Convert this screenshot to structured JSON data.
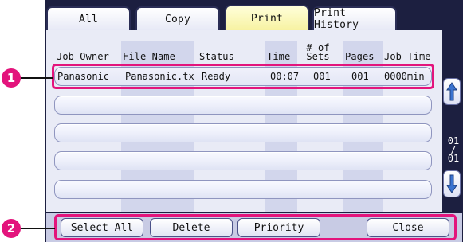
{
  "tabs": [
    {
      "label": "All",
      "active": false
    },
    {
      "label": "Copy",
      "active": false
    },
    {
      "label": "Print",
      "active": true
    },
    {
      "label": "Print History",
      "active": false
    }
  ],
  "columns": {
    "job_owner": "Job Owner",
    "file_name": "File Name",
    "status": "Status",
    "time": "Time",
    "sets_line1": "# of",
    "sets_line2": "Sets",
    "pages": "Pages",
    "job_time": "Job Time"
  },
  "jobs": [
    {
      "owner": "Panasonic",
      "file_name": "Panasonic.tx",
      "status": "Ready",
      "time": "00:07",
      "sets": "001",
      "pages": "001",
      "job_time": "0000min"
    }
  ],
  "pagination": {
    "current": "01",
    "separator": "/",
    "total": "01"
  },
  "buttons": {
    "select_all": "Select All",
    "delete": "Delete",
    "priority": "Priority",
    "close": "Close"
  },
  "callouts": [
    "1",
    "2"
  ],
  "colors": {
    "panel": "#1c1f40",
    "active_tab": "#f7f2a2",
    "highlight": "#e3147c",
    "arrow": "#3a73cf"
  }
}
